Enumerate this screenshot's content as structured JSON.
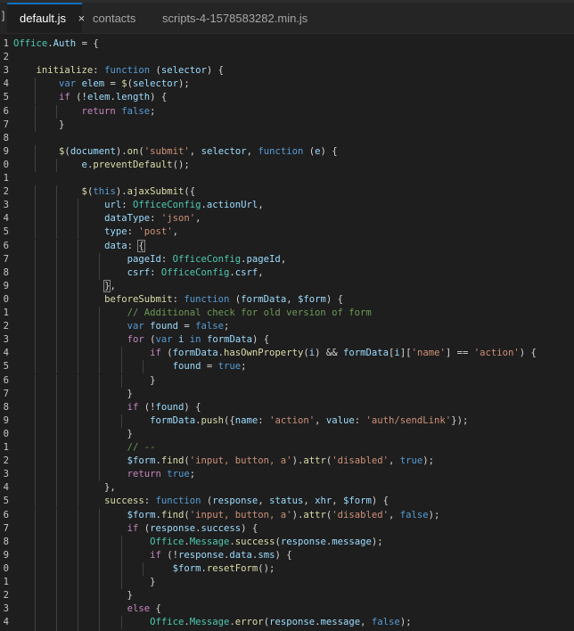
{
  "colors": {
    "background": "#1e1e1e",
    "tabbar": "#252526",
    "active_tab_border": "#0e70c0",
    "keyword": "#569cd6",
    "control": "#c586c0",
    "function": "#dcdcaa",
    "variable": "#9cdcfe",
    "string": "#ce9178",
    "comment": "#6a9955",
    "class": "#4ec9b0",
    "text": "#d4d4d4"
  },
  "tabs": [
    {
      "label": "default.js",
      "active": true,
      "close_icon": "×"
    },
    {
      "label": "contacts",
      "active": false
    },
    {
      "label": "scripts-4-1578583282.min.js",
      "active": false
    }
  ],
  "edge_glyph": "]",
  "lines": [
    {
      "n": "1",
      "tokens": [
        [
          "cls",
          "Office"
        ],
        [
          "pl",
          "."
        ],
        [
          "var",
          "Auth"
        ],
        [
          "pl",
          " = {"
        ]
      ]
    },
    {
      "n": "2",
      "tokens": []
    },
    {
      "n": "3",
      "tokens": [
        [
          "pl",
          "    "
        ],
        [
          "fn",
          "initialize"
        ],
        [
          "pl",
          ": "
        ],
        [
          "kw",
          "function"
        ],
        [
          "pl",
          " ("
        ],
        [
          "var",
          "selector"
        ],
        [
          "pl",
          ") {"
        ]
      ]
    },
    {
      "n": "4",
      "tokens": [
        [
          "pl",
          "        "
        ],
        [
          "kw",
          "var"
        ],
        [
          "pl",
          " "
        ],
        [
          "var",
          "elem"
        ],
        [
          "pl",
          " = "
        ],
        [
          "fn",
          "$"
        ],
        [
          "pl",
          "("
        ],
        [
          "var",
          "selector"
        ],
        [
          "pl",
          ");"
        ]
      ]
    },
    {
      "n": "5",
      "tokens": [
        [
          "pl",
          "        "
        ],
        [
          "ctl",
          "if"
        ],
        [
          "pl",
          " (!"
        ],
        [
          "var",
          "elem"
        ],
        [
          "pl",
          "."
        ],
        [
          "var",
          "length"
        ],
        [
          "pl",
          ") {"
        ]
      ]
    },
    {
      "n": "6",
      "tokens": [
        [
          "pl",
          "            "
        ],
        [
          "ctl",
          "return"
        ],
        [
          "pl",
          " "
        ],
        [
          "kw",
          "false"
        ],
        [
          "pl",
          ";"
        ]
      ]
    },
    {
      "n": "7",
      "tokens": [
        [
          "pl",
          "        }"
        ]
      ]
    },
    {
      "n": "8",
      "tokens": []
    },
    {
      "n": "9",
      "tokens": [
        [
          "pl",
          "        "
        ],
        [
          "fn",
          "$"
        ],
        [
          "pl",
          "("
        ],
        [
          "var",
          "document"
        ],
        [
          "pl",
          ")."
        ],
        [
          "fn",
          "on"
        ],
        [
          "pl",
          "("
        ],
        [
          "str",
          "'submit'"
        ],
        [
          "pl",
          ", "
        ],
        [
          "var",
          "selector"
        ],
        [
          "pl",
          ", "
        ],
        [
          "kw",
          "function"
        ],
        [
          "pl",
          " ("
        ],
        [
          "var",
          "e"
        ],
        [
          "pl",
          ") {"
        ]
      ]
    },
    {
      "n": "0",
      "tokens": [
        [
          "pl",
          "            "
        ],
        [
          "var",
          "e"
        ],
        [
          "pl",
          "."
        ],
        [
          "fn",
          "preventDefault"
        ],
        [
          "pl",
          "();"
        ]
      ]
    },
    {
      "n": "1",
      "tokens": []
    },
    {
      "n": "2",
      "tokens": [
        [
          "pl",
          "            "
        ],
        [
          "fn",
          "$"
        ],
        [
          "pl",
          "("
        ],
        [
          "kw",
          "this"
        ],
        [
          "pl",
          ")."
        ],
        [
          "fn",
          "ajaxSubmit"
        ],
        [
          "pl",
          "({"
        ]
      ]
    },
    {
      "n": "3",
      "tokens": [
        [
          "pl",
          "                "
        ],
        [
          "var",
          "url"
        ],
        [
          "pl",
          ": "
        ],
        [
          "cls",
          "OfficeConfig"
        ],
        [
          "pl",
          "."
        ],
        [
          "var",
          "actionUrl"
        ],
        [
          "pl",
          ","
        ]
      ]
    },
    {
      "n": "4",
      "tokens": [
        [
          "pl",
          "                "
        ],
        [
          "var",
          "dataType"
        ],
        [
          "pl",
          ": "
        ],
        [
          "str",
          "'json'"
        ],
        [
          "pl",
          ","
        ]
      ]
    },
    {
      "n": "5",
      "tokens": [
        [
          "pl",
          "                "
        ],
        [
          "var",
          "type"
        ],
        [
          "pl",
          ": "
        ],
        [
          "str",
          "'post'"
        ],
        [
          "pl",
          ","
        ]
      ]
    },
    {
      "n": "6",
      "tokens": [
        [
          "pl",
          "                "
        ],
        [
          "var",
          "data"
        ],
        [
          "pl",
          ": "
        ],
        [
          "br",
          "{"
        ]
      ]
    },
    {
      "n": "7",
      "tokens": [
        [
          "pl",
          "                    "
        ],
        [
          "var",
          "pageId"
        ],
        [
          "pl",
          ": "
        ],
        [
          "cls",
          "OfficeConfig"
        ],
        [
          "pl",
          "."
        ],
        [
          "var",
          "pageId"
        ],
        [
          "pl",
          ","
        ]
      ]
    },
    {
      "n": "8",
      "tokens": [
        [
          "pl",
          "                    "
        ],
        [
          "var",
          "csrf"
        ],
        [
          "pl",
          ": "
        ],
        [
          "cls",
          "OfficeConfig"
        ],
        [
          "pl",
          "."
        ],
        [
          "var",
          "csrf"
        ],
        [
          "pl",
          ","
        ]
      ]
    },
    {
      "n": "9",
      "tokens": [
        [
          "pl",
          "                "
        ],
        [
          "br",
          "}"
        ],
        [
          "pl",
          ","
        ]
      ]
    },
    {
      "n": "0",
      "tokens": [
        [
          "pl",
          "                "
        ],
        [
          "fn",
          "beforeSubmit"
        ],
        [
          "pl",
          ": "
        ],
        [
          "kw",
          "function"
        ],
        [
          "pl",
          " ("
        ],
        [
          "var",
          "formData"
        ],
        [
          "pl",
          ", "
        ],
        [
          "var",
          "$form"
        ],
        [
          "pl",
          ") {"
        ]
      ]
    },
    {
      "n": "1",
      "tokens": [
        [
          "pl",
          "                    "
        ],
        [
          "cmt",
          "// Additional check for old version of form"
        ]
      ]
    },
    {
      "n": "2",
      "tokens": [
        [
          "pl",
          "                    "
        ],
        [
          "kw",
          "var"
        ],
        [
          "pl",
          " "
        ],
        [
          "var",
          "found"
        ],
        [
          "pl",
          " = "
        ],
        [
          "kw",
          "false"
        ],
        [
          "pl",
          ";"
        ]
      ]
    },
    {
      "n": "3",
      "tokens": [
        [
          "pl",
          "                    "
        ],
        [
          "ctl",
          "for"
        ],
        [
          "pl",
          " ("
        ],
        [
          "kw",
          "var"
        ],
        [
          "pl",
          " "
        ],
        [
          "var",
          "i"
        ],
        [
          "pl",
          " "
        ],
        [
          "kw",
          "in"
        ],
        [
          "pl",
          " "
        ],
        [
          "var",
          "formData"
        ],
        [
          "pl",
          ") {"
        ]
      ]
    },
    {
      "n": "4",
      "tokens": [
        [
          "pl",
          "                        "
        ],
        [
          "ctl",
          "if"
        ],
        [
          "pl",
          " ("
        ],
        [
          "var",
          "formData"
        ],
        [
          "pl",
          "."
        ],
        [
          "fn",
          "hasOwnProperty"
        ],
        [
          "pl",
          "("
        ],
        [
          "var",
          "i"
        ],
        [
          "pl",
          ") && "
        ],
        [
          "var",
          "formData"
        ],
        [
          "pl",
          "["
        ],
        [
          "var",
          "i"
        ],
        [
          "pl",
          "]["
        ],
        [
          "str",
          "'name'"
        ],
        [
          "pl",
          "] == "
        ],
        [
          "str",
          "'action'"
        ],
        [
          "pl",
          ") {"
        ]
      ]
    },
    {
      "n": "5",
      "tokens": [
        [
          "pl",
          "                            "
        ],
        [
          "var",
          "found"
        ],
        [
          "pl",
          " = "
        ],
        [
          "kw",
          "true"
        ],
        [
          "pl",
          ";"
        ]
      ]
    },
    {
      "n": "6",
      "tokens": [
        [
          "pl",
          "                        }"
        ]
      ]
    },
    {
      "n": "7",
      "tokens": [
        [
          "pl",
          "                    }"
        ]
      ]
    },
    {
      "n": "8",
      "tokens": [
        [
          "pl",
          "                    "
        ],
        [
          "ctl",
          "if"
        ],
        [
          "pl",
          " (!"
        ],
        [
          "var",
          "found"
        ],
        [
          "pl",
          ") {"
        ]
      ]
    },
    {
      "n": "9",
      "tokens": [
        [
          "pl",
          "                        "
        ],
        [
          "var",
          "formData"
        ],
        [
          "pl",
          "."
        ],
        [
          "fn",
          "push"
        ],
        [
          "pl",
          "({"
        ],
        [
          "var",
          "name"
        ],
        [
          "pl",
          ": "
        ],
        [
          "str",
          "'action'"
        ],
        [
          "pl",
          ", "
        ],
        [
          "var",
          "value"
        ],
        [
          "pl",
          ": "
        ],
        [
          "str",
          "'auth/sendLink'"
        ],
        [
          "pl",
          "});"
        ]
      ]
    },
    {
      "n": "0",
      "tokens": [
        [
          "pl",
          "                    }"
        ]
      ]
    },
    {
      "n": "1",
      "tokens": [
        [
          "pl",
          "                    "
        ],
        [
          "cmt",
          "// --"
        ]
      ]
    },
    {
      "n": "2",
      "tokens": [
        [
          "pl",
          "                    "
        ],
        [
          "var",
          "$form"
        ],
        [
          "pl",
          "."
        ],
        [
          "fn",
          "find"
        ],
        [
          "pl",
          "("
        ],
        [
          "str",
          "'input, button, a'"
        ],
        [
          "pl",
          ")."
        ],
        [
          "fn",
          "attr"
        ],
        [
          "pl",
          "("
        ],
        [
          "str",
          "'disabled'"
        ],
        [
          "pl",
          ", "
        ],
        [
          "kw",
          "true"
        ],
        [
          "pl",
          ");"
        ]
      ]
    },
    {
      "n": "3",
      "tokens": [
        [
          "pl",
          "                    "
        ],
        [
          "ctl",
          "return"
        ],
        [
          "pl",
          " "
        ],
        [
          "kw",
          "true"
        ],
        [
          "pl",
          ";"
        ]
      ]
    },
    {
      "n": "4",
      "tokens": [
        [
          "pl",
          "                },"
        ]
      ]
    },
    {
      "n": "5",
      "tokens": [
        [
          "pl",
          "                "
        ],
        [
          "fn",
          "success"
        ],
        [
          "pl",
          ": "
        ],
        [
          "kw",
          "function"
        ],
        [
          "pl",
          " ("
        ],
        [
          "var",
          "response"
        ],
        [
          "pl",
          ", "
        ],
        [
          "var",
          "status"
        ],
        [
          "pl",
          ", "
        ],
        [
          "var",
          "xhr"
        ],
        [
          "pl",
          ", "
        ],
        [
          "var",
          "$form"
        ],
        [
          "pl",
          ") {"
        ]
      ]
    },
    {
      "n": "6",
      "tokens": [
        [
          "pl",
          "                    "
        ],
        [
          "var",
          "$form"
        ],
        [
          "pl",
          "."
        ],
        [
          "fn",
          "find"
        ],
        [
          "pl",
          "("
        ],
        [
          "str",
          "'input, button, a'"
        ],
        [
          "pl",
          ")."
        ],
        [
          "fn",
          "attr"
        ],
        [
          "pl",
          "("
        ],
        [
          "str",
          "'disabled'"
        ],
        [
          "pl",
          ", "
        ],
        [
          "kw",
          "false"
        ],
        [
          "pl",
          ");"
        ]
      ]
    },
    {
      "n": "7",
      "tokens": [
        [
          "pl",
          "                    "
        ],
        [
          "ctl",
          "if"
        ],
        [
          "pl",
          " ("
        ],
        [
          "var",
          "response"
        ],
        [
          "pl",
          "."
        ],
        [
          "var",
          "success"
        ],
        [
          "pl",
          ") {"
        ]
      ]
    },
    {
      "n": "8",
      "tokens": [
        [
          "pl",
          "                        "
        ],
        [
          "cls",
          "Office"
        ],
        [
          "pl",
          "."
        ],
        [
          "cls",
          "Message"
        ],
        [
          "pl",
          "."
        ],
        [
          "fn",
          "success"
        ],
        [
          "pl",
          "("
        ],
        [
          "var",
          "response"
        ],
        [
          "pl",
          "."
        ],
        [
          "var",
          "message"
        ],
        [
          "pl",
          ");"
        ]
      ]
    },
    {
      "n": "9",
      "tokens": [
        [
          "pl",
          "                        "
        ],
        [
          "ctl",
          "if"
        ],
        [
          "pl",
          " (!"
        ],
        [
          "var",
          "response"
        ],
        [
          "pl",
          "."
        ],
        [
          "var",
          "data"
        ],
        [
          "pl",
          "."
        ],
        [
          "var",
          "sms"
        ],
        [
          "pl",
          ") {"
        ]
      ]
    },
    {
      "n": "0",
      "tokens": [
        [
          "pl",
          "                            "
        ],
        [
          "var",
          "$form"
        ],
        [
          "pl",
          "."
        ],
        [
          "fn",
          "resetForm"
        ],
        [
          "pl",
          "();"
        ]
      ]
    },
    {
      "n": "1",
      "tokens": [
        [
          "pl",
          "                        }"
        ]
      ]
    },
    {
      "n": "2",
      "tokens": [
        [
          "pl",
          "                    }"
        ]
      ]
    },
    {
      "n": "3",
      "tokens": [
        [
          "pl",
          "                    "
        ],
        [
          "ctl",
          "else"
        ],
        [
          "pl",
          " {"
        ]
      ]
    },
    {
      "n": "4",
      "tokens": [
        [
          "pl",
          "                        "
        ],
        [
          "cls",
          "Office"
        ],
        [
          "pl",
          "."
        ],
        [
          "cls",
          "Message"
        ],
        [
          "pl",
          "."
        ],
        [
          "fn",
          "error"
        ],
        [
          "pl",
          "("
        ],
        [
          "var",
          "response"
        ],
        [
          "pl",
          "."
        ],
        [
          "var",
          "message"
        ],
        [
          "pl",
          ", "
        ],
        [
          "kw",
          "false"
        ],
        [
          "pl",
          ");"
        ]
      ]
    },
    {
      "n": "5",
      "tokens": [
        [
          "pl",
          "                    }"
        ]
      ]
    }
  ]
}
